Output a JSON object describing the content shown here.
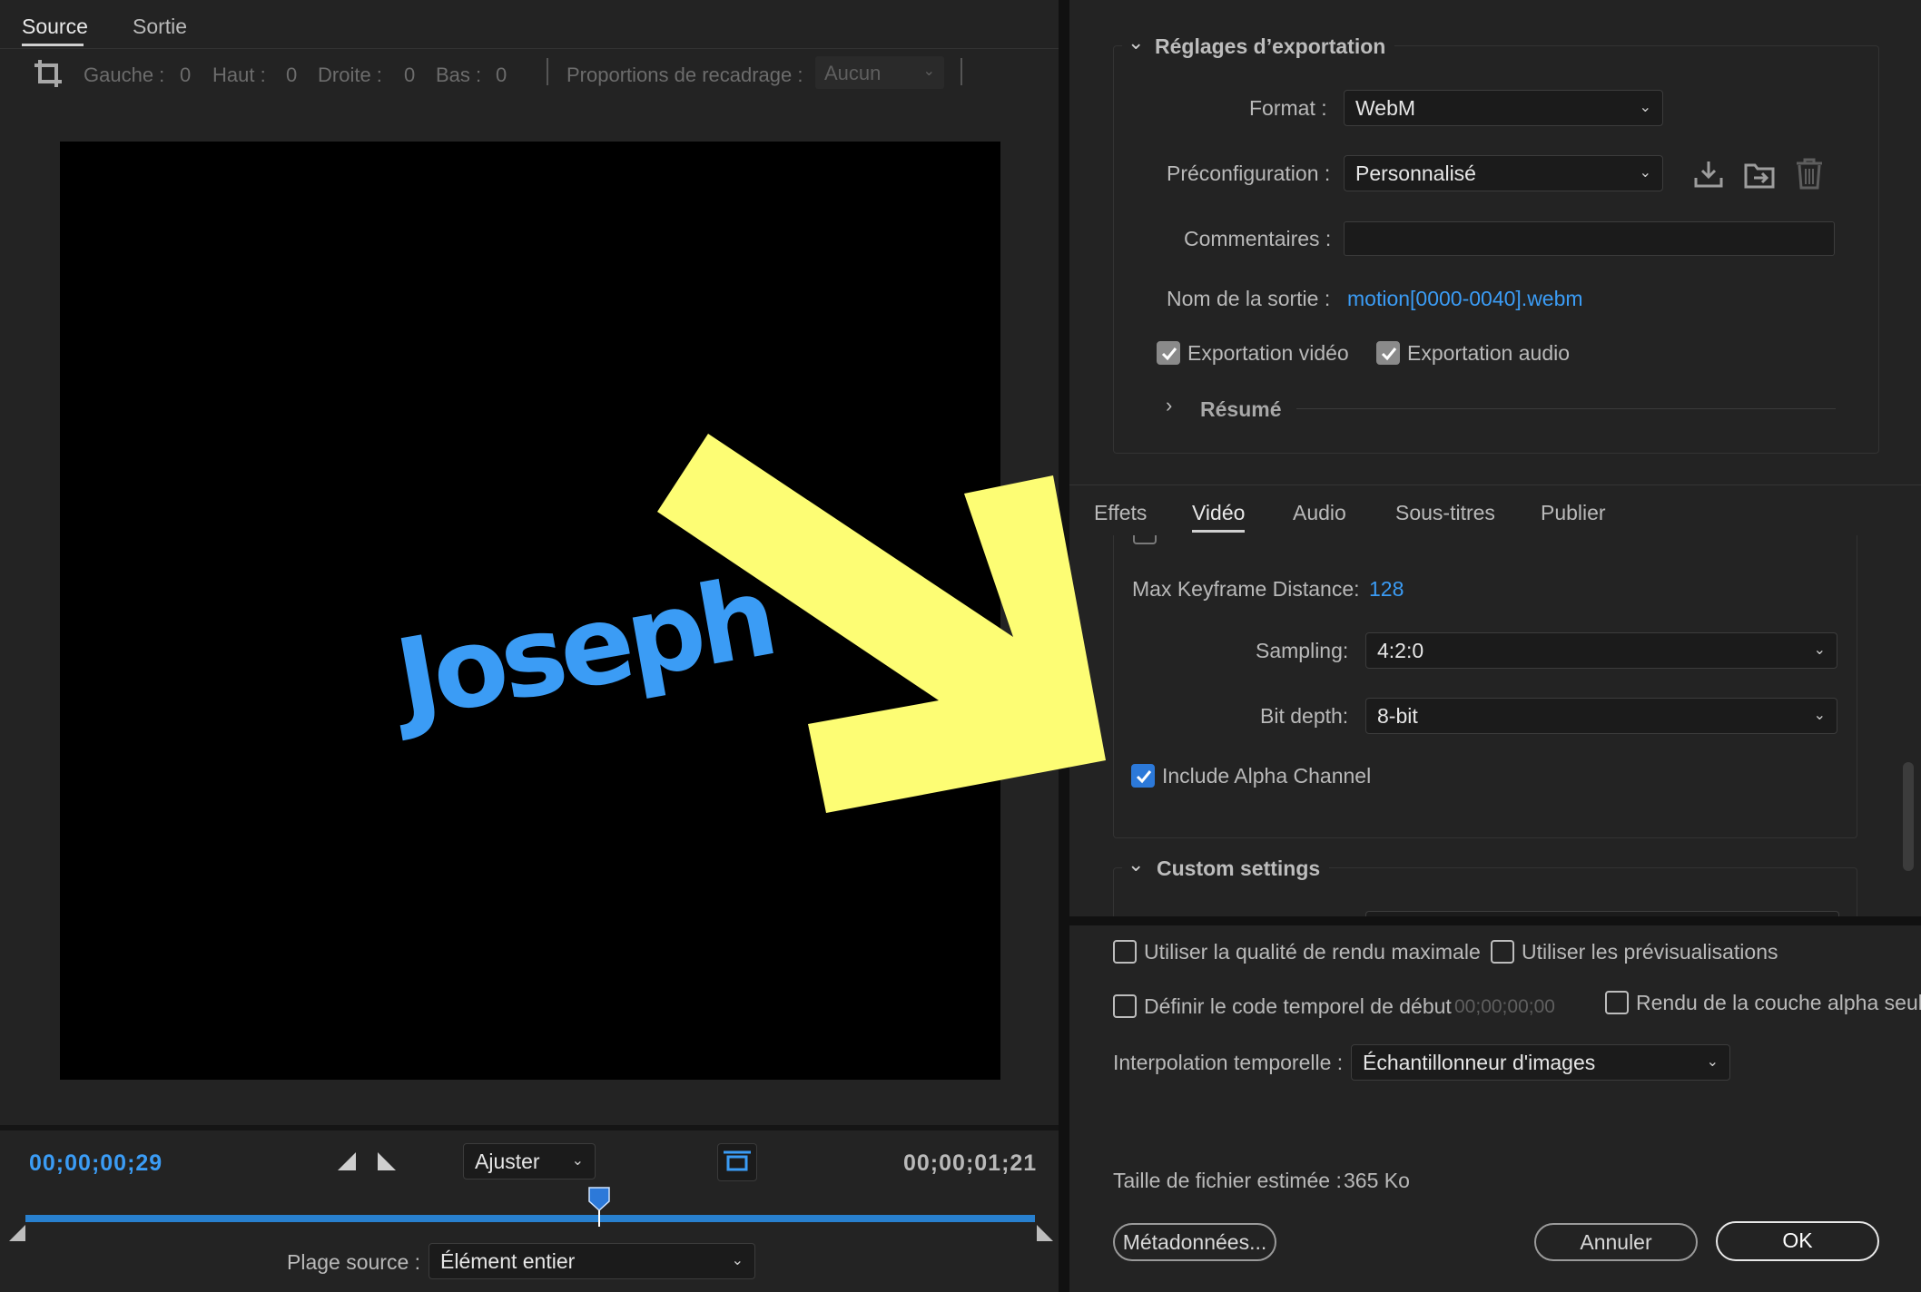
{
  "left": {
    "tabs": [
      "Source",
      "Sortie"
    ],
    "crop": {
      "left_label": "Gauche :",
      "left_value": "0",
      "top_label": "Haut :",
      "top_value": "0",
      "right_label": "Droite :",
      "right_value": "0",
      "bottom_label": "Bas :",
      "bottom_value": "0",
      "ratio_label": "Proportions de recadrage :",
      "ratio_value": "Aucun"
    },
    "preview_text": "Joseph",
    "timecode_current": "00;00;00;29",
    "fit_value": "Ajuster",
    "timecode_end": "00;00;01;21",
    "source_range_label": "Plage source :",
    "source_range_value": "Élément entier"
  },
  "export": {
    "section_title": "Réglages d’exportation",
    "format_label": "Format :",
    "format_value": "WebM",
    "preset_label": "Préconfiguration :",
    "preset_value": "Personnalisé",
    "comments_label": "Commentaires :",
    "comments_value": "",
    "output_label": "Nom de la sortie :",
    "output_value": "motion[0000-0040].webm",
    "export_video_label": "Exportation vidéo",
    "export_audio_label": "Exportation audio",
    "summary_title": "Résumé"
  },
  "tabs": [
    "Effets",
    "Vidéo",
    "Audio",
    "Sous-titres",
    "Publier"
  ],
  "video": {
    "keyframe_label": "Max Keyframe Distance:",
    "keyframe_value": "128",
    "sampling_label": "Sampling:",
    "sampling_value": "4:2:0",
    "bitdepth_label": "Bit depth:",
    "bitdepth_value": "8-bit",
    "alpha_label": "Include Alpha Channel",
    "custom_title": "Custom settings"
  },
  "bottom": {
    "max_quality_label": "Utiliser la qualité de rendu maximale",
    "previews_label": "Utiliser les prévisualisations",
    "start_tc_label": "Définir le code temporel de début",
    "start_tc_value": "00;00;00;00",
    "alpha_only_label": "Rendu de la couche alpha seule",
    "interp_label": "Interpolation temporelle :",
    "interp_value": "Échantillonneur d'images",
    "filesize_label": "Taille de fichier estimée :",
    "filesize_value": "365 Ko",
    "metadata_button": "Métadonnées...",
    "cancel_button": "Annuler",
    "ok_button": "OK"
  },
  "colors": {
    "accent": "#3b9cf5",
    "annotation_arrow": "#fdfd74",
    "panel_bg": "#232323",
    "preview_bg": "#000000"
  }
}
